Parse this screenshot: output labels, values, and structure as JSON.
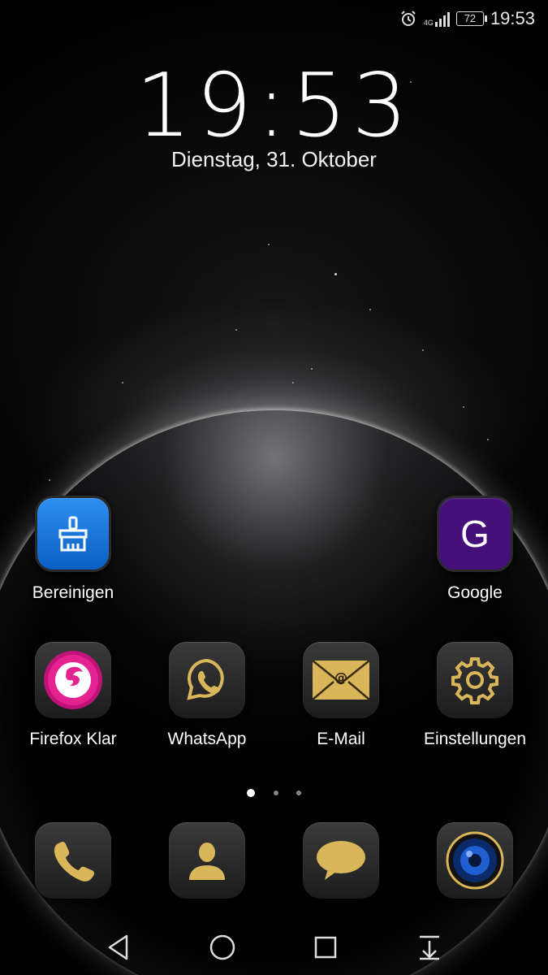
{
  "status_bar": {
    "time": "19:53",
    "battery": "72",
    "network": "4G",
    "icons": [
      "alarm-icon",
      "signal-icon",
      "battery-icon"
    ]
  },
  "lockclock": {
    "time": "19:53",
    "date": "Dienstag, 31. Oktober"
  },
  "apps_row1": [
    {
      "label": "Bereinigen",
      "icon": "broom-icon"
    },
    {
      "label": "Google",
      "icon": "google-icon",
      "glyph": "G"
    }
  ],
  "apps_row2": [
    {
      "label": "Firefox Klar",
      "icon": "firefox-klar-icon"
    },
    {
      "label": "WhatsApp",
      "icon": "whatsapp-icon"
    },
    {
      "label": "E-Mail",
      "icon": "envelope-icon"
    },
    {
      "label": "Einstellungen",
      "icon": "gear-icon"
    }
  ],
  "page_indicator": {
    "pages": 3,
    "current": 1
  },
  "dock": [
    {
      "icon": "phone-icon"
    },
    {
      "icon": "contacts-icon"
    },
    {
      "icon": "messages-icon"
    },
    {
      "icon": "camera-icon"
    }
  ],
  "nav": [
    "back-icon",
    "home-icon",
    "recents-icon",
    "notification-pull-icon"
  ],
  "colors": {
    "gold": "#d9b65a",
    "blue": "#1677e0",
    "purple": "#46107a",
    "pink": "#d4147f"
  }
}
